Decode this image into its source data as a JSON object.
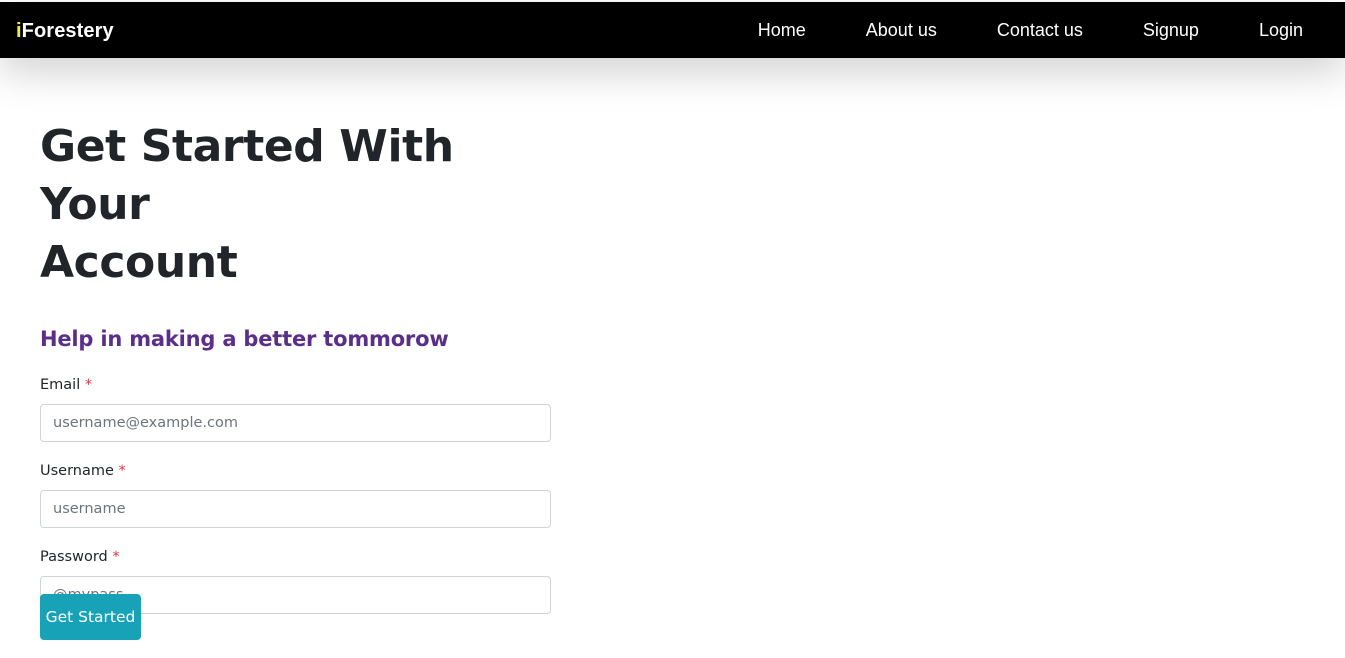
{
  "navbar": {
    "brand_prefix": "i",
    "brand_rest": "Forestery",
    "links": [
      "Home",
      "About us",
      "Contact us",
      "Signup",
      "Login"
    ]
  },
  "page": {
    "title_line1": "Get Started With Your",
    "title_line2": "Account",
    "subtitle": "Help in making a better tommorow"
  },
  "form": {
    "required_marker": "*",
    "email": {
      "label": "Email",
      "placeholder": "username@example.com",
      "value": ""
    },
    "username": {
      "label": "Username",
      "placeholder": "username",
      "value": ""
    },
    "password": {
      "label": "Password",
      "placeholder": "@mypass",
      "value": ""
    },
    "submit_label": "Get Started"
  },
  "colors": {
    "navbar_bg": "#000000",
    "brand_accent": "#f4e94b",
    "subtitle": "#5b2e8a",
    "required": "#dc3545",
    "button": "#17a2b8"
  }
}
